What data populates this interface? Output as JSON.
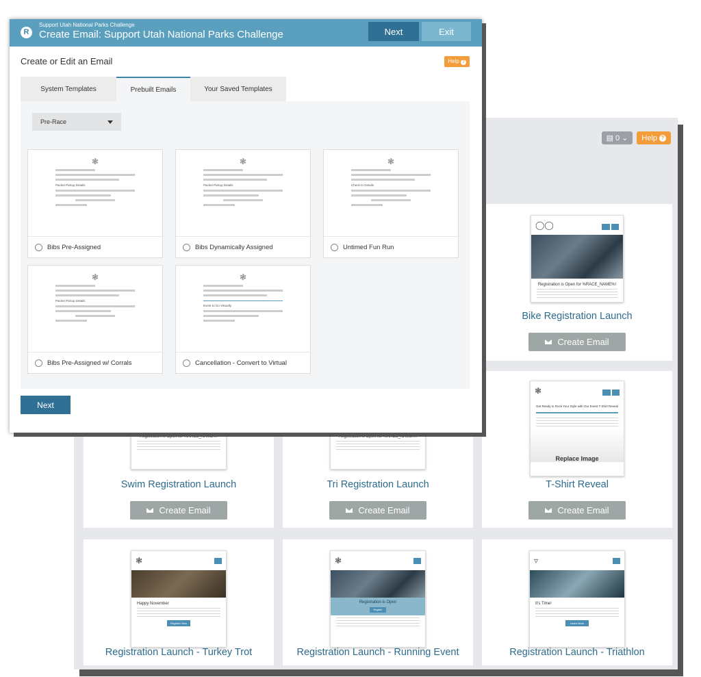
{
  "background": {
    "toolbar": {
      "count": "0",
      "help_label": "Help"
    },
    "cards": [
      {
        "title": "Bike Registration Launch",
        "button": "Create Email",
        "caption": "Registration is Open for %RACE_NAME%!"
      },
      {
        "title": "Swim Registration Launch",
        "button": "Create Email",
        "caption": "Registration is Open for %RACE_NAME%!"
      },
      {
        "title": "Tri Registration Launch",
        "button": "Create Email",
        "caption": "Registration is Open for %RACE_NAME%!"
      },
      {
        "title": "T-Shirt Reveal",
        "button": "Create Email",
        "caption": "Get Ready to Rock Your Style with Our Event T-Shirt Reveal",
        "overlay": "Replace Image"
      },
      {
        "title": "Registration Launch - Turkey Trot",
        "caption": "Happy November",
        "cta": "Register Now"
      },
      {
        "title": "Registration Launch - Running Event",
        "caption": "Registration is Open",
        "cta": "Register"
      },
      {
        "title": "Registration Launch - Triathlon",
        "caption": "It's Time!",
        "cta": "Learn More"
      }
    ]
  },
  "modal": {
    "header": {
      "subtitle": "Support Utah National Parks Challenge",
      "title": "Create Email: Support Utah National Parks Challenge",
      "next_label": "Next",
      "exit_label": "Exit",
      "logo_letter": "R"
    },
    "section_title": "Create or Edit an Email",
    "help_label": "Help",
    "tabs": [
      {
        "label": "System Templates"
      },
      {
        "label": "Prebuilt Emails",
        "active": true
      },
      {
        "label": "Your Saved Templates"
      }
    ],
    "category": "Pre-Race",
    "templates": [
      {
        "label": "Bibs Pre-Assigned",
        "heading": "Packet Pickup Details"
      },
      {
        "label": "Bibs Dynamically Assigned",
        "heading": "Packet Pickup Details"
      },
      {
        "label": "Untimed Fun Run",
        "heading": "Check-In Details"
      },
      {
        "label": "Bibs Pre-Assigned w/ Corrals",
        "heading": "Packet Pickup Details"
      },
      {
        "label": "Cancellation - Convert to Virtual",
        "heading": "Event to Go Virtually"
      }
    ],
    "footer_next": "Next"
  },
  "colors": {
    "accent": "#2f7094",
    "header": "#5aa0be",
    "help": "#f39c3a",
    "create_button": "#9ea6a6"
  }
}
